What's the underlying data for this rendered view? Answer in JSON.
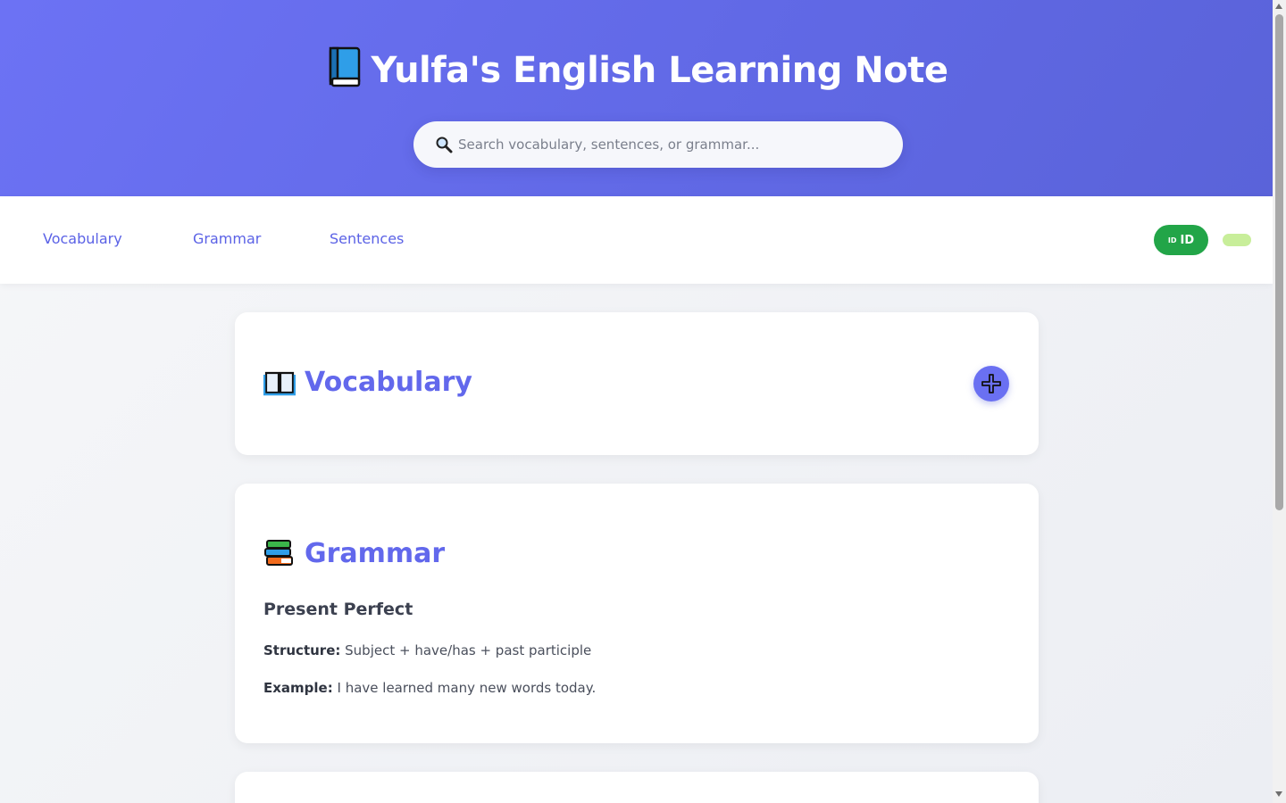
{
  "header": {
    "title": "Yulfa's English Learning Note",
    "title_icon": "blue-book-icon",
    "search": {
      "placeholder": "Search vocabulary, sentences, or grammar...",
      "value": "",
      "icon": "magnifier-icon"
    }
  },
  "nav": {
    "links": [
      "Vocabulary",
      "Grammar",
      "Sentences"
    ],
    "language_button": {
      "flag": "ID",
      "label": "ID"
    },
    "theme_toggle": {
      "state": "light"
    }
  },
  "vocabulary_card": {
    "title": "Vocabulary",
    "icon": "open-book-icon",
    "add_button_icon": "plus-icon"
  },
  "grammar_card": {
    "title": "Grammar",
    "icon": "books-stack-icon",
    "topic": "Present Perfect",
    "structure_label": "Structure:",
    "structure_text": "Subject + have/has + past participle",
    "example_label": "Example:",
    "example_text": "I have learned many new words today."
  },
  "colors": {
    "header_gradient_start": "#6c72f4",
    "header_gradient_end": "#5a63d9",
    "accent": "#6268ec",
    "language_button": "#22a548",
    "toggle": "#c8ee9a"
  }
}
